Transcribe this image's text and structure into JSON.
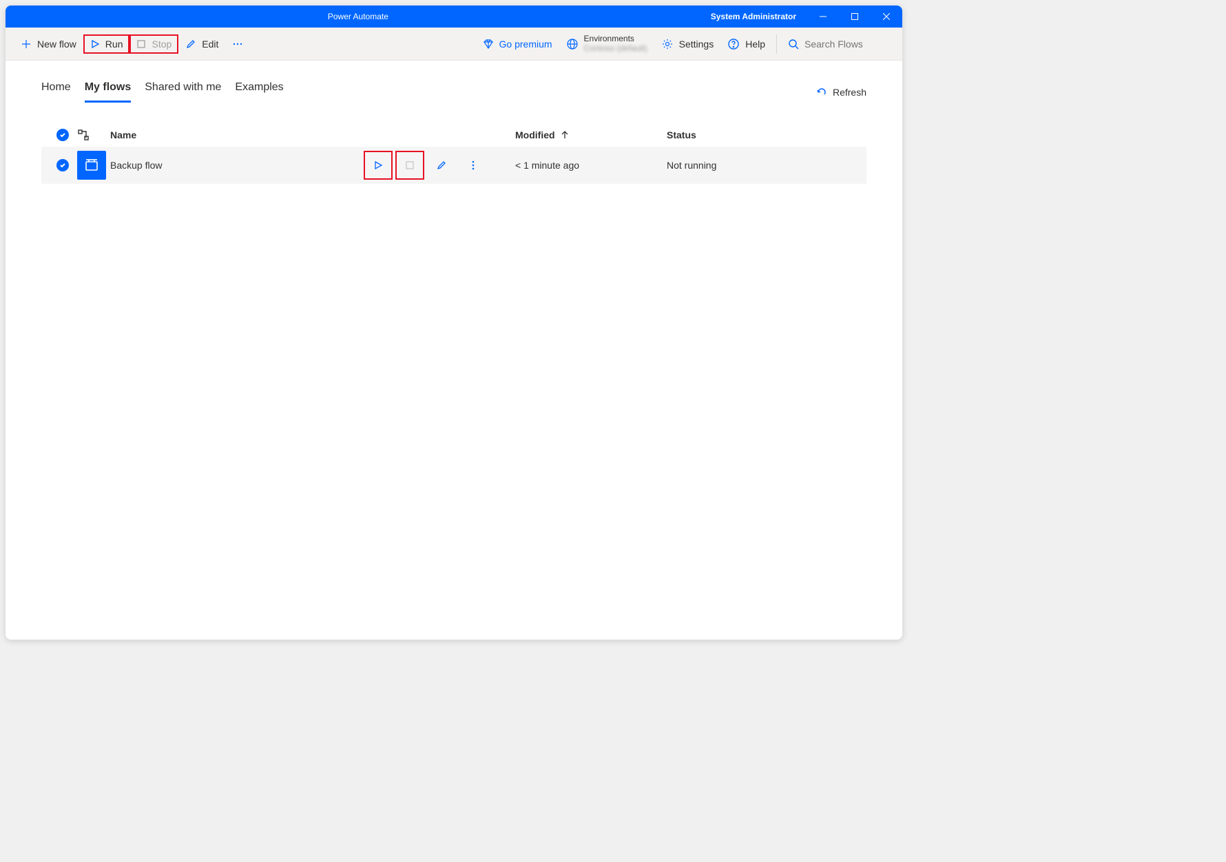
{
  "window": {
    "title": "Power Automate",
    "user": "System Administrator"
  },
  "toolbar": {
    "new_flow": "New flow",
    "run": "Run",
    "stop": "Stop",
    "edit": "Edit",
    "go_premium": "Go premium",
    "environments": "Environments",
    "env_name": "Contoso (default)",
    "settings": "Settings",
    "help": "Help",
    "search_placeholder": "Search Flows"
  },
  "tabs": {
    "home": "Home",
    "my_flows": "My flows",
    "shared": "Shared with me",
    "examples": "Examples"
  },
  "refresh": "Refresh",
  "columns": {
    "name": "Name",
    "modified": "Modified",
    "status": "Status"
  },
  "rows": [
    {
      "name": "Backup flow",
      "modified": "< 1 minute ago",
      "status": "Not running"
    }
  ]
}
